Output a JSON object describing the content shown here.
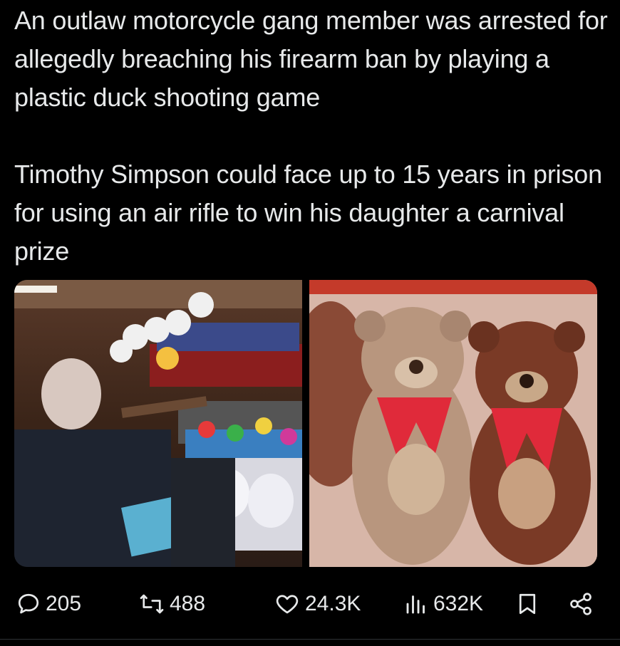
{
  "tweet": {
    "paragraph1": "An outlaw motorcycle gang member was arrested for allegedly breaching his firearm ban by playing a plastic duck shooting game",
    "paragraph2": "Timothy Simpson could face up to 15 years in prison for using an air rifle to win his daughter a carnival prize"
  },
  "media": {
    "left_alt": "man aiming air rifle at carnival shooting stall",
    "right_alt": "teddy bears with red scarves"
  },
  "actions": {
    "replies": "205",
    "reposts": "488",
    "likes": "24.3K",
    "views": "632K"
  },
  "icons": {
    "reply": "reply-icon",
    "repost": "repost-icon",
    "like": "heart-icon",
    "views": "views-icon",
    "bookmark": "bookmark-icon",
    "share": "share-icon"
  },
  "colors": {
    "background": "#000000",
    "text": "#e7e9ea"
  }
}
